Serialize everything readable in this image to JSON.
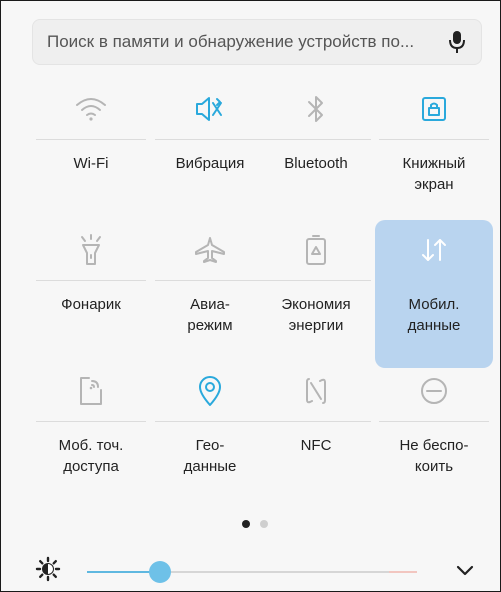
{
  "search": {
    "placeholder": "Поиск в памяти и обнаружение устройств по..."
  },
  "tiles": [
    {
      "label": "Wi-Fi",
      "icon": "wifi-icon",
      "active": false,
      "accent": false
    },
    {
      "label": "Вибрация",
      "icon": "vibration-icon",
      "active": false,
      "accent": true
    },
    {
      "label": "Bluetooth",
      "icon": "bluetooth-icon",
      "active": false,
      "accent": false
    },
    {
      "label": "Книжный\nэкран",
      "icon": "portrait-lock-icon",
      "active": false,
      "accent": true
    },
    {
      "label": "Фонарик",
      "icon": "flashlight-icon",
      "active": false,
      "accent": false
    },
    {
      "label": "Авиа-\nрежим",
      "icon": "airplane-icon",
      "active": false,
      "accent": false
    },
    {
      "label": "Экономия\nэнергии",
      "icon": "power-saving-icon",
      "active": false,
      "accent": false
    },
    {
      "label": "Мобил.\nданные",
      "icon": "mobile-data-icon",
      "active": true,
      "accent": false
    },
    {
      "label": "Моб. точ.\nдоступа",
      "icon": "hotspot-icon",
      "active": false,
      "accent": false
    },
    {
      "label": "Гео-\nданные",
      "icon": "location-icon",
      "active": false,
      "accent": true
    },
    {
      "label": "NFC",
      "icon": "nfc-icon",
      "active": false,
      "accent": false
    },
    {
      "label": "Не беспо-\nкоить",
      "icon": "do-not-disturb-icon",
      "active": false,
      "accent": false
    }
  ],
  "pagination": {
    "pages": 2,
    "current": 0
  },
  "brightness": {
    "level": 0.22
  },
  "colors": {
    "accent": "#2aa9dc",
    "inactive_icon": "#b5b5b5",
    "active_tile": "#b9d4ef",
    "slider_fill": "#5fb8e0"
  }
}
